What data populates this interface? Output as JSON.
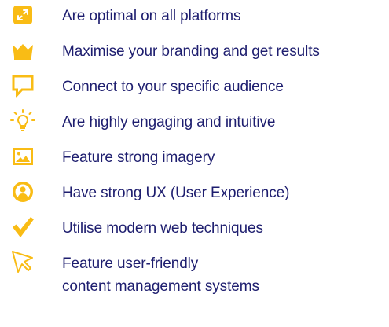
{
  "theme": {
    "text_color": "#1e1e6f",
    "icon_color": "#f9bc15"
  },
  "features": [
    {
      "icon": "resize-expand-icon",
      "label": "Are optimal on all platforms"
    },
    {
      "icon": "crown-icon",
      "label": "Maximise your branding and get results"
    },
    {
      "icon": "speech-bubble-icon",
      "label": "Connect to your specific audience"
    },
    {
      "icon": "lightbulb-icon",
      "label": "Are highly engaging and intuitive"
    },
    {
      "icon": "image-icon",
      "label": "Feature strong imagery"
    },
    {
      "icon": "user-circle-icon",
      "label": "Have strong UX (User Experience)"
    },
    {
      "icon": "checkmark-icon",
      "label": "Utilise modern web techniques"
    },
    {
      "icon": "cursor-pointer-icon",
      "label_line1": "Feature user-friendly",
      "label_line2": "content management systems"
    }
  ]
}
